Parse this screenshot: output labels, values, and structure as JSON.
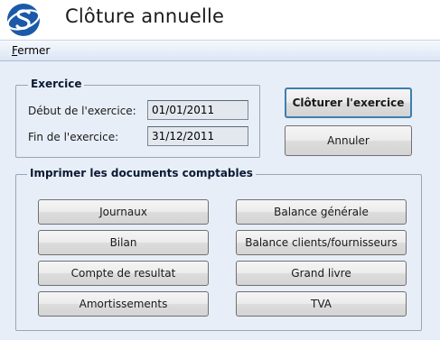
{
  "window": {
    "title": "Clôture annuelle"
  },
  "menu": {
    "fermer_first": "F",
    "fermer_rest": "ermer"
  },
  "exercice": {
    "legend": "Exercice",
    "debut_label": "Début de l'exercice:",
    "debut_value": "01/01/2011",
    "fin_label": "Fin de l'exercice:",
    "fin_value": "31/12/2011"
  },
  "actions": {
    "cloturer": "Clôturer l'exercice",
    "annuler": "Annuler"
  },
  "documents": {
    "legend": "Imprimer les documents comptables",
    "journaux": "Journaux",
    "bilan": "Bilan",
    "compte_resultat": "Compte de resultat",
    "amortissements": "Amortissements",
    "balance_generale": "Balance générale",
    "balance_clients": "Balance clients/fournisseurs",
    "grand_livre": "Grand livre",
    "tva": "TVA"
  },
  "colors": {
    "logo_blue": "#1a5aa8",
    "accent_border": "#3c7fb1"
  },
  "icons": {
    "logo": "app-logo-icon"
  }
}
